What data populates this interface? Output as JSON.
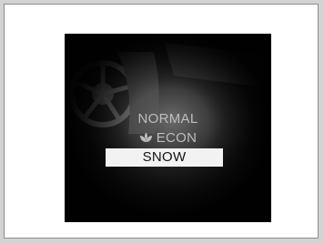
{
  "display": {
    "modes": [
      {
        "label": "NORMAL",
        "selected": false
      },
      {
        "label": "ECON",
        "selected": false,
        "icon": "econ-leaf-icon"
      },
      {
        "label": "SNOW",
        "selected": true
      }
    ],
    "selected_mode": "SNOW"
  },
  "colors": {
    "page_background": "#d3d3d3",
    "frame_background": "#ffffff",
    "screen_background": "#121212",
    "unselected_text": "#bdbdbd",
    "selected_highlight": "#f2f2f2",
    "selected_text": "#111111"
  }
}
